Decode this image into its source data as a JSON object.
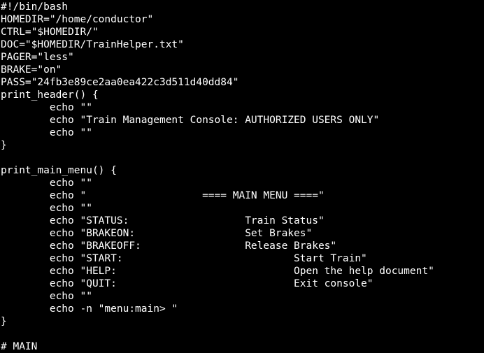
{
  "terminal": {
    "foreground": "#ffffff",
    "background": "#000000",
    "lines": [
      "#!/bin/bash",
      "HOMEDIR=\"/home/conductor\"",
      "CTRL=\"$HOMEDIR/\"",
      "DOC=\"$HOMEDIR/TrainHelper.txt\"",
      "PAGER=\"less\"",
      "BRAKE=\"on\"",
      "PASS=\"24fb3e89ce2aa0ea422c3d511d40dd84\"",
      "print_header() {",
      "        echo \"\"",
      "        echo \"Train Management Console: AUTHORIZED USERS ONLY\"",
      "        echo \"\"",
      "}",
      "",
      "print_main_menu() {",
      "        echo \"\"",
      "        echo \"                   ==== MAIN MENU ====\"",
      "        echo \"\"",
      "        echo \"STATUS:                   Train Status\"",
      "        echo \"BRAKEON:                  Set Brakes\"",
      "        echo \"BRAKEOFF:                 Release Brakes\"",
      "        echo \"START:                            Start Train\"",
      "        echo \"HELP:                             Open the help document\"",
      "        echo \"QUIT:                             Exit console\"",
      "        echo \"\"",
      "        echo -n \"menu:main> \"",
      "}",
      "",
      "# MAIN"
    ]
  }
}
